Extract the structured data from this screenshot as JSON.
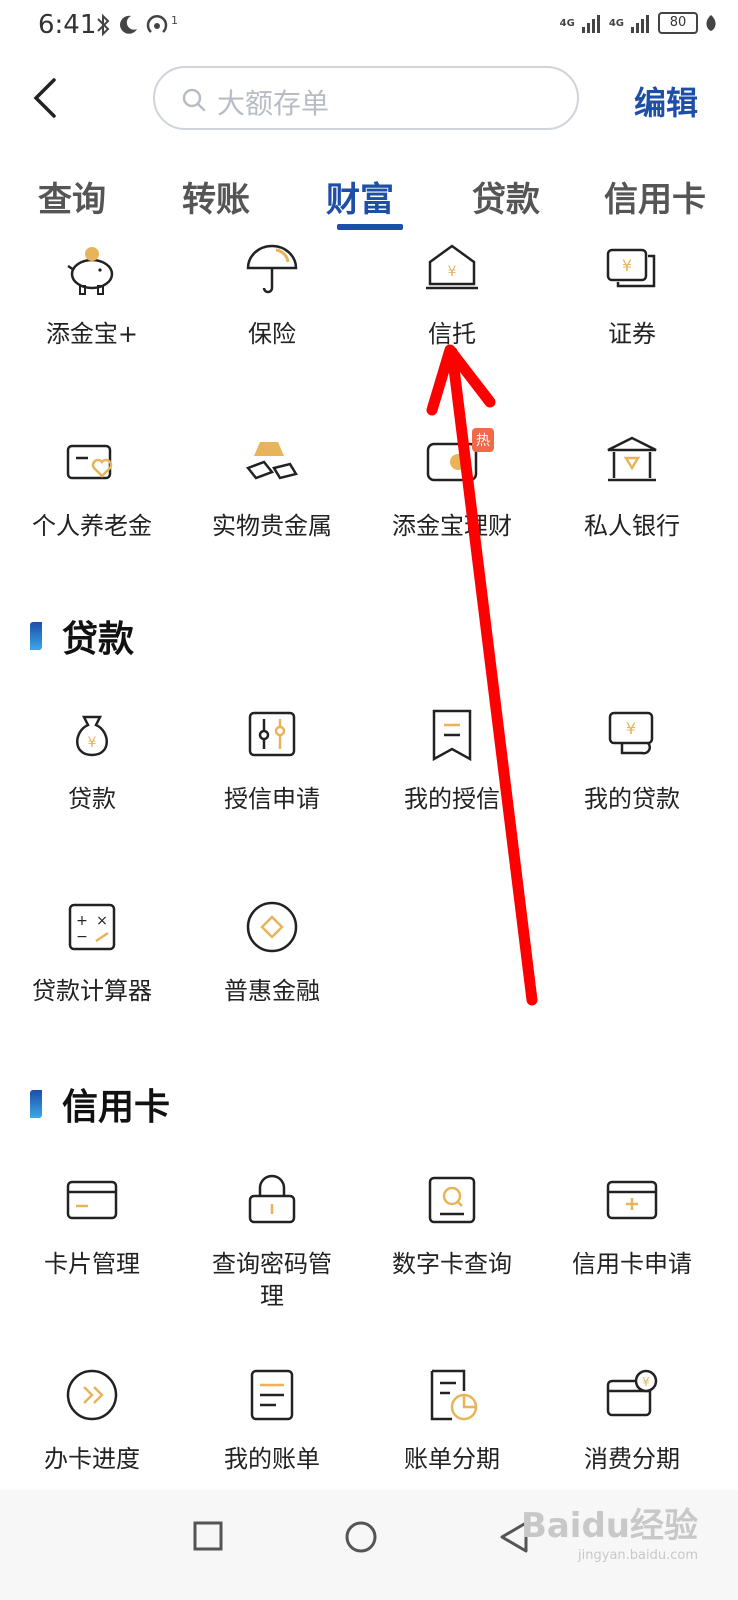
{
  "status": {
    "time": "6:41",
    "network1": "4G",
    "network2": "4G",
    "battery": "80",
    "hotspot_count": "1"
  },
  "header": {
    "search_placeholder": "大额存单",
    "edit_label": "编辑"
  },
  "tabs": [
    {
      "label": "查询"
    },
    {
      "label": "转账"
    },
    {
      "label": "财富",
      "active": true
    },
    {
      "label": "贷款"
    },
    {
      "label": "信用卡"
    }
  ],
  "wealth": {
    "items": [
      {
        "label": "添金宝+",
        "icon": "piggy-bank-icon"
      },
      {
        "label": "保险",
        "icon": "umbrella-icon"
      },
      {
        "label": "信托",
        "icon": "trust-icon"
      },
      {
        "label": "证券",
        "icon": "securities-icon"
      },
      {
        "label": "个人养老金",
        "icon": "pension-card-icon"
      },
      {
        "label": "实物贵金属",
        "icon": "gold-bar-icon"
      },
      {
        "label": "添金宝理财",
        "icon": "wallet-icon",
        "badge": "热"
      },
      {
        "label": "私人银行",
        "icon": "private-bank-icon"
      }
    ]
  },
  "loan": {
    "title": "贷款",
    "items": [
      {
        "label": "贷款",
        "icon": "money-bag-icon"
      },
      {
        "label": "授信申请",
        "icon": "credit-apply-icon"
      },
      {
        "label": "我的授信",
        "icon": "bookmark-icon"
      },
      {
        "label": "我的贷款",
        "icon": "my-loan-icon"
      },
      {
        "label": "贷款计算器",
        "icon": "calculator-icon"
      },
      {
        "label": "普惠金融",
        "icon": "coin-icon"
      }
    ]
  },
  "credit_card": {
    "title": "信用卡",
    "items": [
      {
        "label": "卡片管理",
        "icon": "card-icon"
      },
      {
        "label": "查询密码管理",
        "line1": "查询密码管",
        "line2": "理",
        "icon": "lock-icon"
      },
      {
        "label": "数字卡查询",
        "icon": "search-card-icon"
      },
      {
        "label": "信用卡申请",
        "icon": "card-apply-icon"
      },
      {
        "label": "办卡进度",
        "icon": "progress-icon"
      },
      {
        "label": "我的账单",
        "icon": "bill-icon"
      },
      {
        "label": "账单分期",
        "icon": "bill-installment-icon"
      },
      {
        "label": "消费分期",
        "icon": "consume-installment-icon"
      }
    ]
  },
  "watermark": {
    "text": "Baidu经验",
    "sub": "jingyan.baidu.com"
  },
  "colors": {
    "accent": "#1d4ea8",
    "gold": "#e8b45a",
    "arrow": "#ff0000"
  }
}
